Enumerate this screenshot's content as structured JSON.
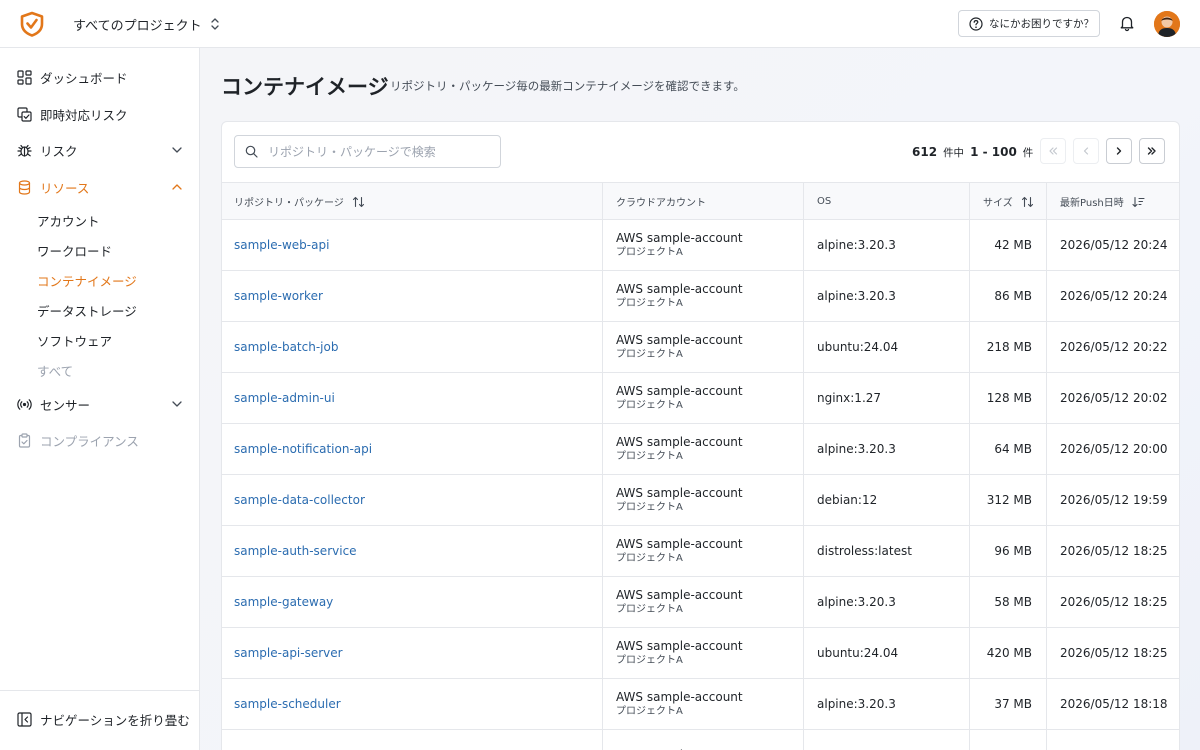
{
  "header": {
    "project_selector": "すべてのプロジェクト",
    "help_label": "なにかお困りですか？"
  },
  "sidebar": {
    "items": [
      {
        "label": "ダッシュボード",
        "icon": "dashboard-icon"
      },
      {
        "label": "即時対応リスク",
        "icon": "immediate-risk-icon"
      },
      {
        "label": "リスク",
        "icon": "bug-icon"
      },
      {
        "label": "リソース",
        "icon": "database-icon"
      },
      {
        "label": "センサー",
        "icon": "sensor-icon"
      },
      {
        "label": "コンプライアンス",
        "icon": "clipboard-icon"
      }
    ],
    "resource_sub_items": [
      "アカウント",
      "ワークロード",
      "コンテナイメージ",
      "データストレージ",
      "ソフトウェア",
      "すべて"
    ],
    "collapse_label": "ナビゲーションを折り畳む"
  },
  "main": {
    "title": "コンテナイメージ",
    "description": "リポジトリ・パッケージ毎の最新コンテナイメージを確認できます。",
    "search_placeholder": "リポジトリ・パッケージで検索",
    "pagination": {
      "total": "612",
      "total_unit": "件中",
      "range": "1 - 100",
      "range_unit": "件"
    },
    "columns": [
      "リポジトリ・パッケージ",
      "クラウドアカウント",
      "OS",
      "サイズ",
      "最新Push日時"
    ],
    "rows": [
      {
        "repo": "sample-web-api",
        "account": "AWS sample-account",
        "project": "プロジェクトA",
        "os": "alpine:3.20.3",
        "size": "42 MB",
        "pushed": "2026/05/12 20:24"
      },
      {
        "repo": "sample-worker",
        "account": "AWS sample-account",
        "project": "プロジェクトA",
        "os": "alpine:3.20.3",
        "size": "86 MB",
        "pushed": "2026/05/12 20:24"
      },
      {
        "repo": "sample-batch-job",
        "account": "AWS sample-account",
        "project": "プロジェクトA",
        "os": "ubuntu:24.04",
        "size": "218 MB",
        "pushed": "2026/05/12 20:22"
      },
      {
        "repo": "sample-admin-ui",
        "account": "AWS sample-account",
        "project": "プロジェクトA",
        "os": "nginx:1.27",
        "size": "128 MB",
        "pushed": "2026/05/12 20:02"
      },
      {
        "repo": "sample-notification-api",
        "account": "AWS sample-account",
        "project": "プロジェクトA",
        "os": "alpine:3.20.3",
        "size": "64 MB",
        "pushed": "2026/05/12 20:00"
      },
      {
        "repo": "sample-data-collector",
        "account": "AWS sample-account",
        "project": "プロジェクトA",
        "os": "debian:12",
        "size": "312 MB",
        "pushed": "2026/05/12 19:59"
      },
      {
        "repo": "sample-auth-service",
        "account": "AWS sample-account",
        "project": "プロジェクトA",
        "os": "distroless:latest",
        "size": "96 MB",
        "pushed": "2026/05/12 18:25"
      },
      {
        "repo": "sample-gateway",
        "account": "AWS sample-account",
        "project": "プロジェクトA",
        "os": "alpine:3.20.3",
        "size": "58 MB",
        "pushed": "2026/05/12 18:25"
      },
      {
        "repo": "sample-api-server",
        "account": "AWS sample-account",
        "project": "プロジェクトA",
        "os": "ubuntu:24.04",
        "size": "420 MB",
        "pushed": "2026/05/12 18:25"
      },
      {
        "repo": "sample-scheduler",
        "account": "AWS sample-account",
        "project": "プロジェクトA",
        "os": "alpine:3.20.3",
        "size": "37 MB",
        "pushed": "2026/05/12 18:18"
      },
      {
        "repo": "",
        "account": "AWS sample-account",
        "project": "",
        "os": "",
        "size": "",
        "pushed": ""
      }
    ]
  },
  "colors": {
    "accent": "#e2771a",
    "link": "#2b6cb0",
    "text": "#1f2328",
    "muted": "#9ca3af"
  }
}
